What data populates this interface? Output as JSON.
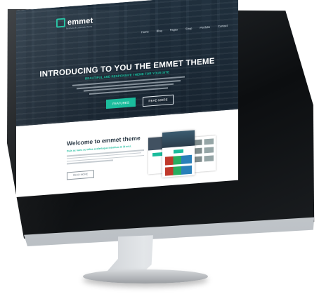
{
  "site": {
    "brand": "emmet",
    "tagline": "business & corporate theme"
  },
  "nav": {
    "items": [
      "Home",
      "Blog",
      "Pages",
      "Shop",
      "Portfolio",
      "Contact"
    ]
  },
  "hero": {
    "title": "INTRODUCING TO YOU THE EMMET THEME",
    "subtitle": "BEAUTIFUL AND RESPONSIVE THEME FOR YOUR SITE",
    "features_label": "FEATURES",
    "read_more_label": "READ MORE"
  },
  "welcome": {
    "title": "Welcome to emmet theme",
    "subtitle": "Duis ac nunc ac tellus scelerisque interdum in id orci.",
    "read_more_label": "READ MORE"
  },
  "colors": {
    "accent": "#1abc9c",
    "hero_overlay": "#1c2c3a",
    "heading": "#2b3a46"
  },
  "icons": {
    "brand_mark": "emmet-logo-icon"
  }
}
